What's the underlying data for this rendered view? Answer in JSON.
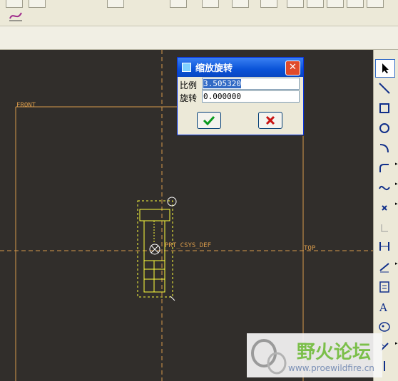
{
  "app": {
    "title": "缩放旋转"
  },
  "dialog": {
    "title": "缩放旋转",
    "scale_label": "比例",
    "scale_value": "3.505320",
    "rotate_label": "旋转",
    "rotate_value": "0.000000",
    "ok_icon": "checkmark-icon",
    "cancel_icon": "x-icon"
  },
  "canvas": {
    "datum_front": "FRONT",
    "datum_top": "TOP",
    "csys_label": "PRT_CSYS_DEF",
    "colors": {
      "background": "#312e2b",
      "datum": "#d79a4b",
      "sketch": "#ffff3c"
    }
  },
  "tools": [
    "select-arrow-icon",
    "line-icon",
    "rectangle-icon",
    "circle-icon",
    "arc-icon",
    "fillet-icon",
    "spline-icon",
    "point-icon",
    "coordinate-icon",
    "dimension-icon",
    "modify-icon",
    "constraint-icon",
    "text-icon",
    "palette-icon",
    "trim-icon",
    "divide-icon"
  ],
  "watermark": {
    "text": "野火论坛",
    "url": "www.proewildfire.cn"
  }
}
